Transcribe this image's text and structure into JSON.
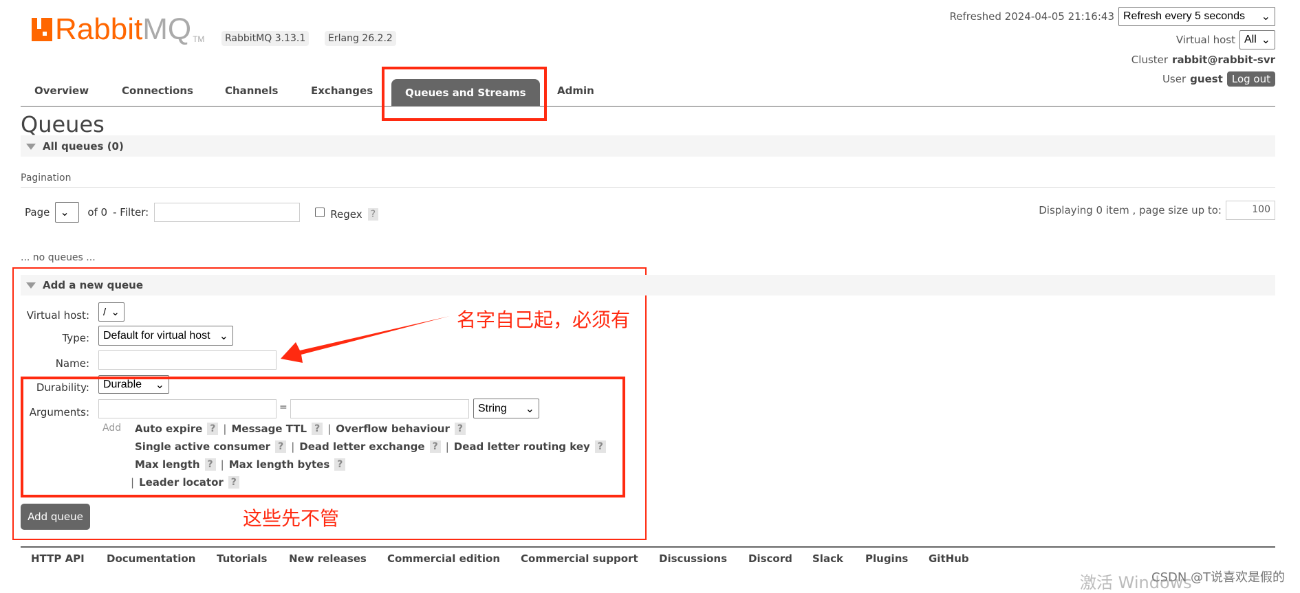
{
  "header": {
    "logo_text_primary": "Rabbit",
    "logo_text_secondary": "MQ",
    "logo_tm": "TM",
    "version_badge": "RabbitMQ 3.13.1",
    "erlang_badge": "Erlang 26.2.2",
    "refreshed": "Refreshed 2024-04-05 21:16:43",
    "refresh_select": "Refresh every 5 seconds",
    "vhost_label": "Virtual host",
    "vhost_select": "All",
    "cluster_label": "Cluster",
    "cluster_name": "rabbit@rabbit-svr",
    "user_label": "User",
    "user_name": "guest",
    "logout": "Log out"
  },
  "nav": {
    "tabs": [
      "Overview",
      "Connections",
      "Channels",
      "Exchanges",
      "Queues and Streams",
      "Admin"
    ],
    "active": "Queues and Streams"
  },
  "page": {
    "title": "Queues",
    "all_queues": "All queues (0)",
    "pagination": "Pagination",
    "page_label": "Page",
    "of": "of 0",
    "filter_label": "- Filter:",
    "regex_label": "Regex",
    "help": "?",
    "displaying": "Displaying 0 item , page size up to:",
    "page_size": "100",
    "no_queues": "... no queues ..."
  },
  "add_queue": {
    "title": "Add a new queue",
    "vhost_label": "Virtual host:",
    "vhost_value": "/",
    "type_label": "Type:",
    "type_value": "Default for virtual host",
    "name_label": "Name:",
    "name_value": "",
    "durability_label": "Durability:",
    "durability_value": "Durable",
    "arguments_label": "Arguments:",
    "equals": "=",
    "arg_type": "String",
    "add": "Add",
    "arg_rows": [
      [
        "Auto expire",
        "Message TTL",
        "Overflow behaviour"
      ],
      [
        "Single active consumer",
        "Dead letter exchange",
        "Dead letter routing key"
      ],
      [
        "Max length",
        "Max length bytes"
      ],
      [
        "Leader locator"
      ]
    ],
    "submit": "Add queue"
  },
  "annotations": {
    "name_note": "名字自己起，必须有",
    "args_note": "这些先不管",
    "accent": "#ff2a10"
  },
  "footer": {
    "links": [
      "HTTP API",
      "Documentation",
      "Tutorials",
      "New releases",
      "Commercial edition",
      "Commercial support",
      "Discussions",
      "Discord",
      "Slack",
      "Plugins",
      "GitHub"
    ]
  },
  "watermark": {
    "windows": "激活 Windows",
    "csdn": "CSDN @T说喜欢是假的"
  }
}
